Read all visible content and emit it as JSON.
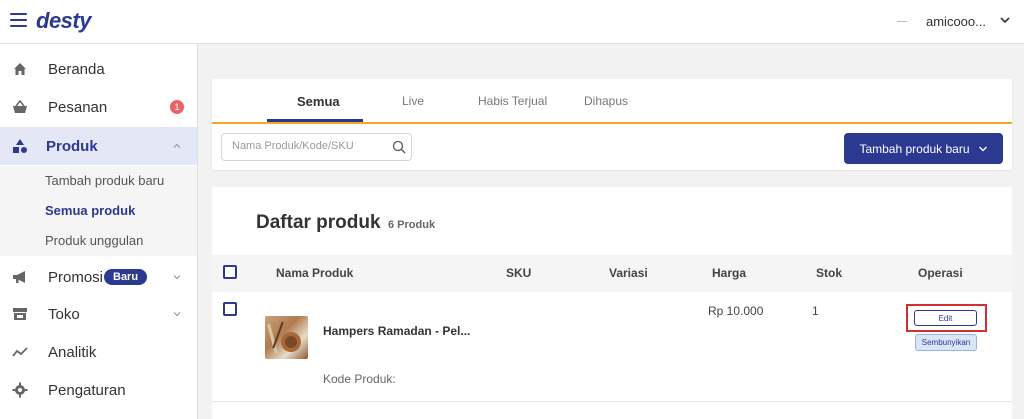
{
  "header": {
    "logo": "desty",
    "user_name": "amicooo..."
  },
  "sidebar": {
    "items": [
      {
        "label": "Beranda",
        "icon": "home-icon"
      },
      {
        "label": "Pesanan",
        "icon": "basket-icon",
        "badge": "1"
      },
      {
        "label": "Produk",
        "icon": "shapes-icon"
      },
      {
        "label": "Promosi",
        "icon": "megaphone-icon",
        "badge": "Baru"
      },
      {
        "label": "Toko",
        "icon": "store-icon"
      },
      {
        "label": "Analitik",
        "icon": "chart-line-icon"
      },
      {
        "label": "Pengaturan",
        "icon": "gear-icon"
      }
    ],
    "produk_sub": [
      "Tambah produk baru",
      "Semua produk",
      "Produk unggulan"
    ]
  },
  "tabs": [
    "Semua",
    "Live",
    "Habis Terjual",
    "Dihapus"
  ],
  "search": {
    "placeholder": "Nama Produk/Kode/SKU"
  },
  "add_button": "Tambah produk baru",
  "list": {
    "title": "Daftar produk",
    "count": "6 Produk",
    "columns": [
      "Nama Produk",
      "SKU",
      "Variasi",
      "Harga",
      "Stok",
      "Operasi"
    ],
    "rows": [
      {
        "name": "Hampers Ramadan - Pel...",
        "code_label": "Kode Produk:",
        "price": "Rp 10.000",
        "stock": "1",
        "edit": "Edit",
        "hide": "Sembunyikan"
      }
    ]
  },
  "colors": {
    "primary": "#2b3990",
    "accent": "#f6a623",
    "highlight": "#d32f2f",
    "badge_red": "#e96565"
  }
}
